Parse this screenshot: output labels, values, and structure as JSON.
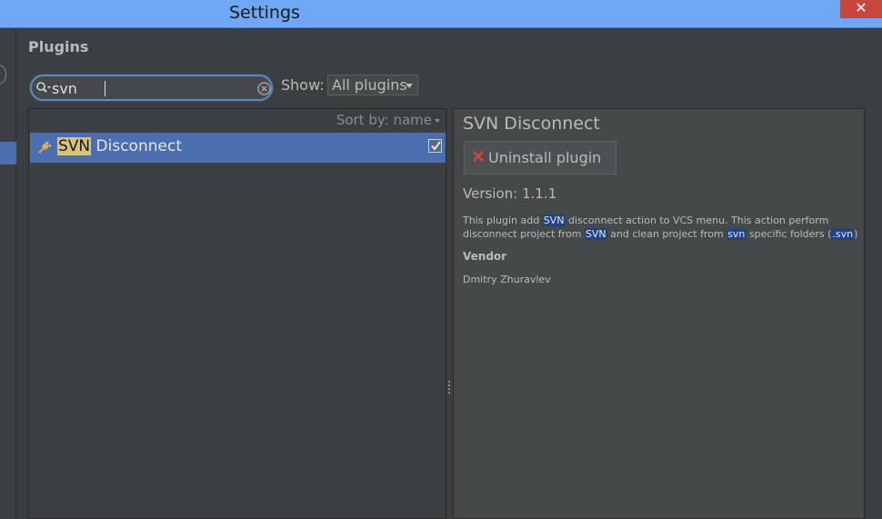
{
  "window": {
    "title": "Settings",
    "close_glyph": "✕"
  },
  "page": {
    "heading": "Plugins"
  },
  "search": {
    "value": "svn"
  },
  "filter": {
    "label": "Show:",
    "selected": "All plugins"
  },
  "list": {
    "sort_label": "Sort by: name",
    "items": [
      {
        "name_highlight": "SVN",
        "name_rest": " Disconnect",
        "enabled": true
      }
    ]
  },
  "detail": {
    "title": "SVN Disconnect",
    "uninstall_label": "Uninstall plugin",
    "version": "Version: 1.1.1",
    "description": {
      "p1": "This plugin add ",
      "h1": "SVN",
      "p2": " disconnect action to VCS menu. This action perform disconnect project from ",
      "h2": "SVN",
      "p3": " and clean project from ",
      "h3": "svn",
      "p4": " specific folders (",
      "h4": ".svn",
      "p5": ")"
    },
    "vendor_label": "Vendor",
    "vendor_name": "Dmitry Zhuravlev"
  },
  "colors": {
    "title_bar": "#6fa8f2",
    "selection": "#4b6eaf",
    "search_highlight": "#d6c27c",
    "text_highlight": "#214283",
    "close_button": "#c7463d"
  },
  "icons": {
    "search": "search-icon",
    "clear": "clear-search-icon",
    "plugin": "plugin-plug-icon",
    "uninstall": "red-x-icon",
    "splitter": "splitter-grip-icon"
  }
}
